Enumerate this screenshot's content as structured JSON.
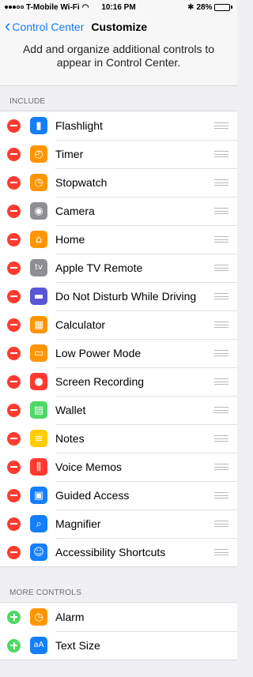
{
  "status_bar": {
    "carrier": "T-Mobile Wi-Fi",
    "time": "10:16 PM",
    "battery": "28%",
    "battery_level": 0.28
  },
  "nav": {
    "back_label": "Control Center",
    "title": "Customize"
  },
  "intro_text": "Add and organize additional controls to appear in Control Center.",
  "include": {
    "header": "INCLUDE",
    "items": [
      {
        "label": "Flashlight",
        "icon": "flashlight-icon",
        "color": "#157efb"
      },
      {
        "label": "Timer",
        "icon": "timer-icon",
        "color": "#ff9500"
      },
      {
        "label": "Stopwatch",
        "icon": "stopwatch-icon",
        "color": "#ff9500"
      },
      {
        "label": "Camera",
        "icon": "camera-icon",
        "color": "#8e8e93"
      },
      {
        "label": "Home",
        "icon": "home-icon",
        "color": "#ff9500"
      },
      {
        "label": "Apple TV Remote",
        "icon": "apple-tv-icon",
        "color": "#8e8e93"
      },
      {
        "label": "Do Not Disturb While Driving",
        "icon": "car-icon",
        "color": "#5856d6"
      },
      {
        "label": "Calculator",
        "icon": "calculator-icon",
        "color": "#ff9500"
      },
      {
        "label": "Low Power Mode",
        "icon": "battery-icon",
        "color": "#ff9500"
      },
      {
        "label": "Screen Recording",
        "icon": "record-icon",
        "color": "#ff3b30"
      },
      {
        "label": "Wallet",
        "icon": "wallet-icon",
        "color": "#4cd964"
      },
      {
        "label": "Notes",
        "icon": "notes-icon",
        "color": "#ffcc00"
      },
      {
        "label": "Voice Memos",
        "icon": "voice-memos-icon",
        "color": "#ff3b30"
      },
      {
        "label": "Guided Access",
        "icon": "lock-icon",
        "color": "#157efb"
      },
      {
        "label": "Magnifier",
        "icon": "magnifier-icon",
        "color": "#157efb"
      },
      {
        "label": "Accessibility Shortcuts",
        "icon": "accessibility-icon",
        "color": "#157efb"
      }
    ]
  },
  "more_controls": {
    "header": "MORE CONTROLS",
    "items": [
      {
        "label": "Alarm",
        "icon": "alarm-icon",
        "color": "#ff9500"
      },
      {
        "label": "Text Size",
        "icon": "text-size-icon",
        "color": "#157efb"
      }
    ]
  }
}
